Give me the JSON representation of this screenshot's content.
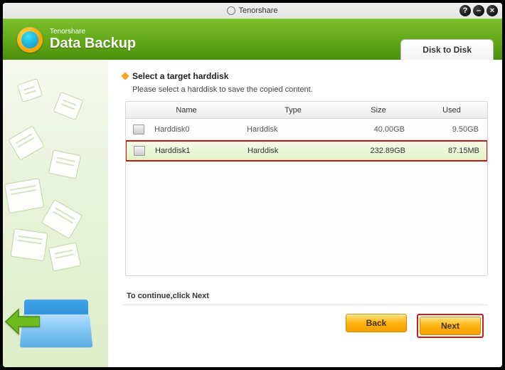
{
  "titlebar": {
    "app_name": "Tenorshare"
  },
  "header": {
    "brand": "Tenorshare",
    "product": "Data Backup",
    "tab": "Disk to Disk"
  },
  "section": {
    "title": "Select a target harddisk",
    "subtitle": "Please select a harddisk to save the copied content."
  },
  "columns": {
    "name": "Name",
    "type": "Type",
    "size": "Size",
    "used": "Used"
  },
  "disks": [
    {
      "name": "Harddisk0",
      "type": "Harddisk",
      "size": "40.00GB",
      "used": "9.50GB",
      "selected": false
    },
    {
      "name": "Harddisk1",
      "type": "Harddisk",
      "size": "232.89GB",
      "used": "87.15MB",
      "selected": true
    }
  ],
  "hint": "To continue,click Next",
  "buttons": {
    "back": "Back",
    "next": "Next"
  }
}
